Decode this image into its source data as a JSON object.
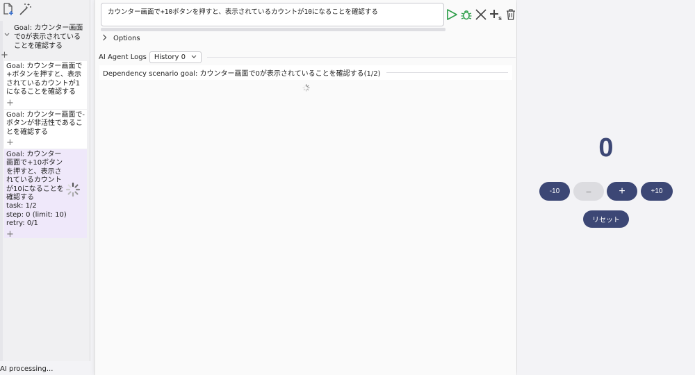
{
  "left": {
    "root_goal": "Goal: カウンター画面で0が表示されていることを確認する",
    "cards": [
      {
        "text": "Goal: カウンター画面で+ボタンを押すと、表示されているカウントが1になることを確認する"
      },
      {
        "text": "Goal: カウンター画面で-ボタンが非活性であることを確認する"
      }
    ],
    "active_card": {
      "text": "Goal: カウンター画面で+10ボタンを押すと、表示されているカウントが10になることを確認する",
      "task": "task: 1/2",
      "step": "step: 0 (limit: 10)",
      "retry": "retry: 0/1"
    },
    "plus_symbol": "+"
  },
  "main": {
    "prompt": "カウンター画面で+10ボタンを押すと、表示されているカウントが10になることを確認する",
    "options_label": "Options",
    "logs_label": "AI Agent Logs",
    "history_label": "History 0",
    "dependency_text": "Dependency scenario goal: カウンター画面で0が表示されていることを確認する(1/2)"
  },
  "counter": {
    "value": "0",
    "minus10": "-10",
    "minus": "−",
    "plus": "+",
    "plus10": "+10",
    "reset": "リセット"
  },
  "status": "AI processing...",
  "colors": {
    "accent": "#3c4775",
    "run_green": "#2e9e4a",
    "active_card_bg": "#efe8fa"
  },
  "icons": [
    "new-file-icon",
    "magic-wand-icon",
    "play-icon",
    "bug-icon",
    "close-icon",
    "add-step-icon",
    "trash-icon",
    "chevron-down-icon",
    "chevron-right-icon",
    "spinner-icon"
  ]
}
